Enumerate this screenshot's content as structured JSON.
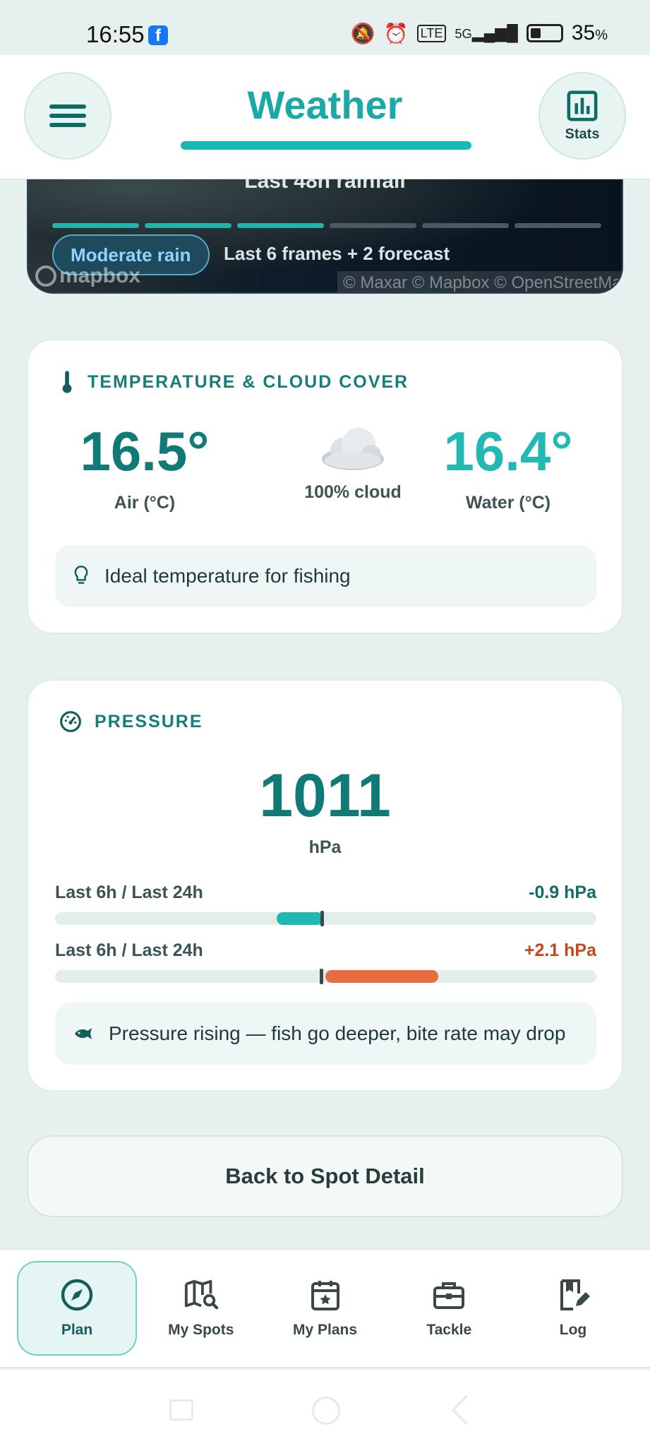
{
  "status_bar": {
    "time": "16:55",
    "battery_pct": "35",
    "battery_suffix": "%",
    "network": "5G"
  },
  "header": {
    "title": "Weather",
    "stats_label": "Stats"
  },
  "map": {
    "title": "Last 48h rainfall",
    "rain_chip": "Moderate rain",
    "frames_text": "Last 6 frames + 2 forecast",
    "logo_text": "mapbox",
    "attribution": "© Maxar © Mapbox © OpenStreetMap",
    "segments_active": 3,
    "segments_total": 6
  },
  "temperature": {
    "heading": "TEMPERATURE & CLOUD COVER",
    "air_value": "16.5°",
    "air_label": "Air (°C)",
    "cloud_label": "100% cloud",
    "water_value": "16.4°",
    "water_label": "Water (°C)",
    "tip": "Ideal temperature for fishing"
  },
  "pressure": {
    "heading": "PRESSURE",
    "value": "1011",
    "unit": "hPa",
    "trend1_label": "Last 6h / Last 24h",
    "trend1_value": "-0.9 hPa",
    "trend2_label": "Last 6h / Last 24h",
    "trend2_value": "+2.1 hPa",
    "tip": "Pressure rising — fish go deeper, bite rate may drop"
  },
  "back_button": "Back to Spot Detail",
  "nav": [
    {
      "label": "Plan",
      "icon": "compass-icon",
      "active": true
    },
    {
      "label": "My Spots",
      "icon": "map-search-icon",
      "active": false
    },
    {
      "label": "My Plans",
      "icon": "calendar-star-icon",
      "active": false
    },
    {
      "label": "Tackle",
      "icon": "toolbox-icon",
      "active": false
    },
    {
      "label": "Log",
      "icon": "notebook-edit-icon",
      "active": false
    }
  ],
  "colors": {
    "accent": "#1aa9a6",
    "accent_dark": "#0f7a76",
    "pressure_down": "#20b8b3",
    "pressure_up": "#e66d3f"
  }
}
